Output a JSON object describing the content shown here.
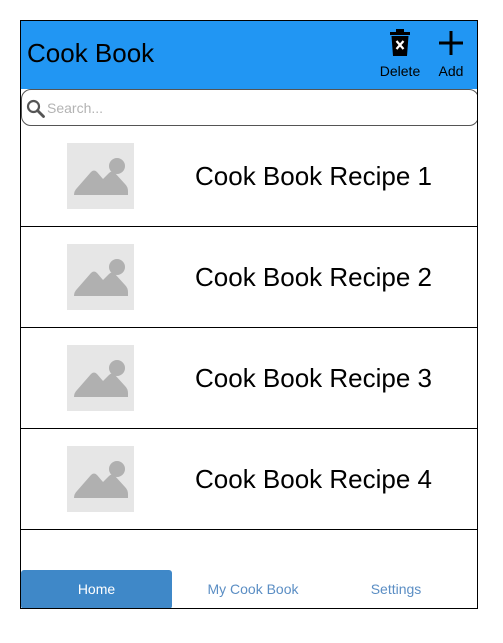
{
  "header": {
    "title": "Cook Book",
    "accent_color": "#2196f3",
    "actions": [
      {
        "label": "Delete",
        "icon": "trash-icon"
      },
      {
        "label": "Add",
        "icon": "plus-icon"
      }
    ]
  },
  "search": {
    "placeholder": "Search...",
    "value": "",
    "icon": "search-icon"
  },
  "recipes": [
    {
      "title": "Cook Book Recipe 1",
      "image": "image-placeholder-icon"
    },
    {
      "title": "Cook Book Recipe 2",
      "image": "image-placeholder-icon"
    },
    {
      "title": "Cook Book Recipe 3",
      "image": "image-placeholder-icon"
    },
    {
      "title": "Cook Book Recipe 4",
      "image": "image-placeholder-icon"
    }
  ],
  "nav": {
    "tabs": [
      {
        "label": "Home",
        "active": true
      },
      {
        "label": "My Cook Book",
        "active": false
      },
      {
        "label": "Settings",
        "active": false
      }
    ],
    "active_color": "#3f88c8",
    "inactive_text_color": "#5b8ec4"
  }
}
